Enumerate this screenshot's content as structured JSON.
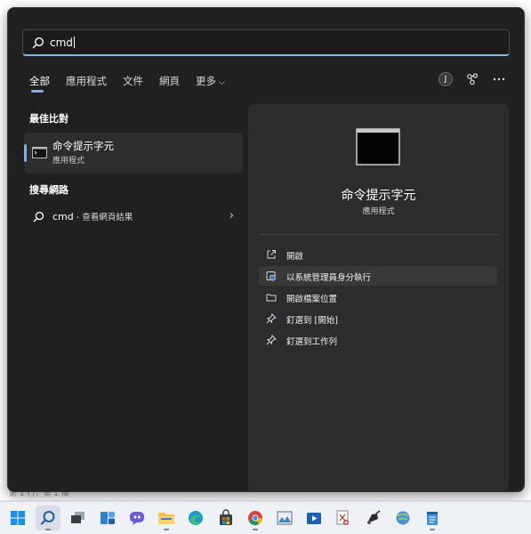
{
  "search": {
    "query": "cmd"
  },
  "tabs": [
    {
      "label": "全部",
      "active": true
    },
    {
      "label": "應用程式",
      "active": false
    },
    {
      "label": "文件",
      "active": false
    },
    {
      "label": "網頁",
      "active": false
    },
    {
      "label": "更多",
      "active": false,
      "dropdown": true
    }
  ],
  "header_right": {
    "avatar_letter": "J"
  },
  "best_match": {
    "section_title": "最佳比對",
    "name": "命令提示字元",
    "type": "應用程式"
  },
  "web_search": {
    "section_title": "搜尋網路",
    "term": "cmd",
    "suffix": " - 查看網頁結果"
  },
  "detail": {
    "name": "命令提示字元",
    "type": "應用程式",
    "actions": [
      {
        "label": "開啟",
        "icon": "open-external-icon"
      },
      {
        "label": "以系統管理員身分執行",
        "icon": "admin-shield-icon"
      },
      {
        "label": "開啟檔案位置",
        "icon": "folder-icon"
      },
      {
        "label": "釘選到 [開始]",
        "icon": "pin-icon"
      },
      {
        "label": "釘選到工作列",
        "icon": "pin-icon"
      }
    ]
  },
  "background": {
    "status_text": "第 1 行，第 1 欄"
  },
  "taskbar": {
    "items": [
      "windows-start-icon",
      "search-icon",
      "task-view-icon",
      "widgets-icon",
      "chat-icon",
      "file-explorer-icon",
      "edge-icon",
      "store-icon",
      "chrome-icon",
      "photos-icon",
      "media-icon",
      "snip-icon",
      "paint-icon",
      "network-icon",
      "notepad-icon"
    ]
  },
  "colors": {
    "accent": "#7fb0e0",
    "panel_bg": "#202020",
    "detail_bg": "#2c2c2c"
  }
}
